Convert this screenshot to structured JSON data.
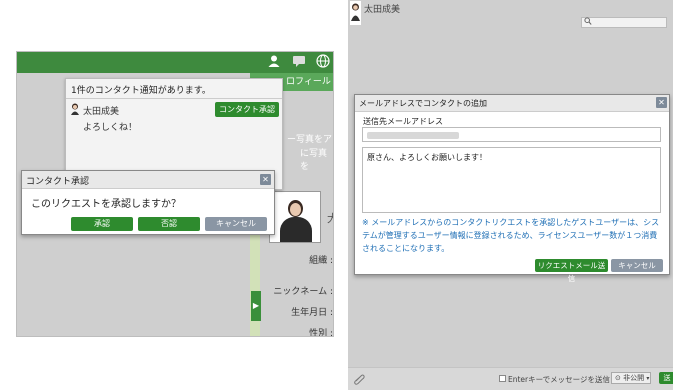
{
  "left": {
    "profile_tab": "ロフィール",
    "faint_text_1": "ー写真をア",
    "faint_text_2": "に写真を",
    "name_edge": "大",
    "labels": [
      "組織 :",
      "ニックネーム :",
      "生年月日 :",
      "性別 :"
    ],
    "notification": {
      "title": "1件のコンタクト通知があります。",
      "sender_name": "太田成美",
      "message": "よろしくね！",
      "approve_contact_label": "コンタクト承認"
    },
    "confirm_dialog": {
      "title": "コンタクト承認",
      "question": "このリクエストを承認しますか？",
      "approve_label": "承認",
      "reject_label": "否認",
      "cancel_label": "キャンセル"
    }
  },
  "right": {
    "header_name": "太田成美",
    "dialog": {
      "title": "メールアドレスでコンタクトの追加",
      "email_label": "送信先メールアドレス",
      "email_value": "",
      "message_value": "原さん、よろしくお願いします！",
      "note": "※ メールアドレスからのコンタクトリクエストを承認したゲストユーザーは、システムが管理するユーザー情報に登録されるため、ライセンスユーザー数が１つ消費されることになります。",
      "send_label": "リクエストメール送信",
      "cancel_label": "キャンセル"
    },
    "footer": {
      "enter_send_label": "Enterキーでメッセージを送信",
      "visibility_label": "非公開",
      "send_edge_label": "送"
    }
  },
  "icons": {
    "user": "user-icon",
    "chat": "chat-icon",
    "globe": "globe-icon",
    "search": "search-icon",
    "attach": "paperclip-icon",
    "close": "close-icon"
  },
  "colors": {
    "brand_green": "#3e8a3e",
    "button_green": "#2e8b2e",
    "button_gray": "#8a96a4",
    "note_blue": "#1f6fb5"
  }
}
